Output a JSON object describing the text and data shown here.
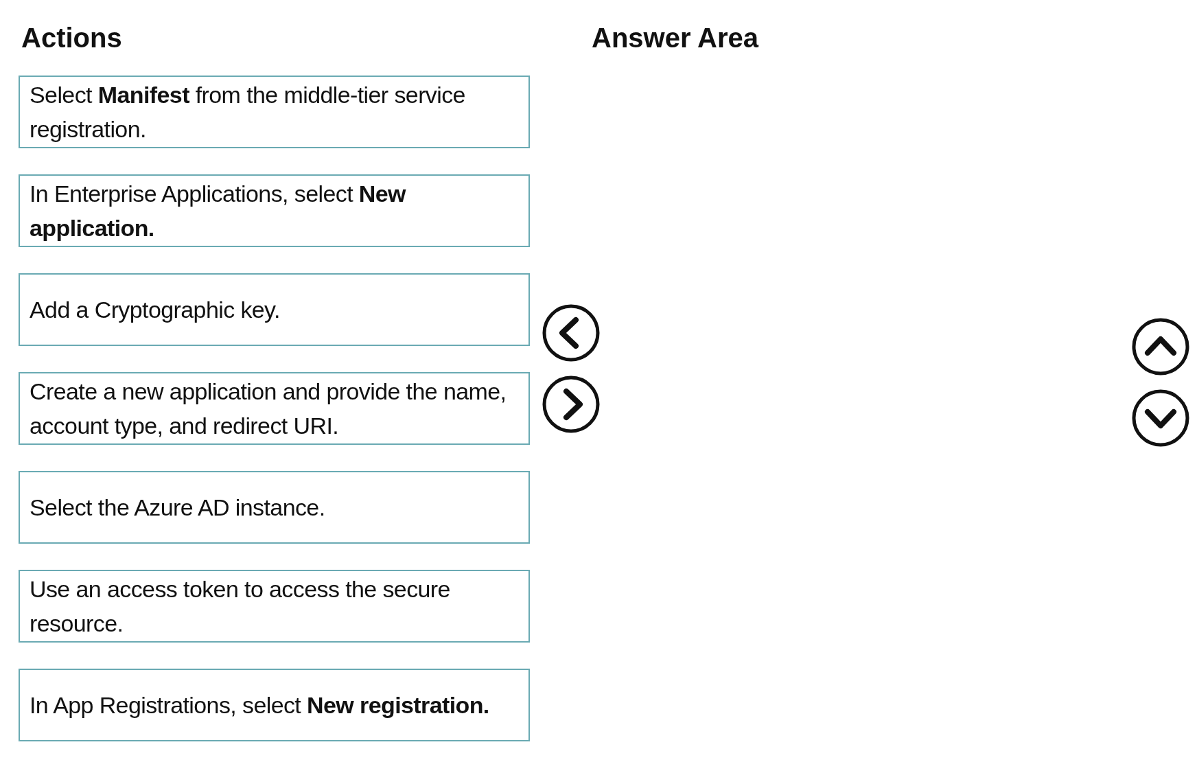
{
  "actions": {
    "title": "Actions",
    "items": [
      {
        "text": "Select **Manifest** from the middle-tier service registration."
      },
      {
        "text": "In Enterprise Applications, select **New application.**"
      },
      {
        "text": "Add a Cryptographic key."
      },
      {
        "text": "Create a new application and provide the name, account type, and redirect URI."
      },
      {
        "text": "Select the Azure AD instance."
      },
      {
        "text": "Use an access token to access the secure resource."
      },
      {
        "text": "In App Registrations, select **New registration.**"
      }
    ]
  },
  "answer_area": {
    "title": "Answer Area"
  }
}
